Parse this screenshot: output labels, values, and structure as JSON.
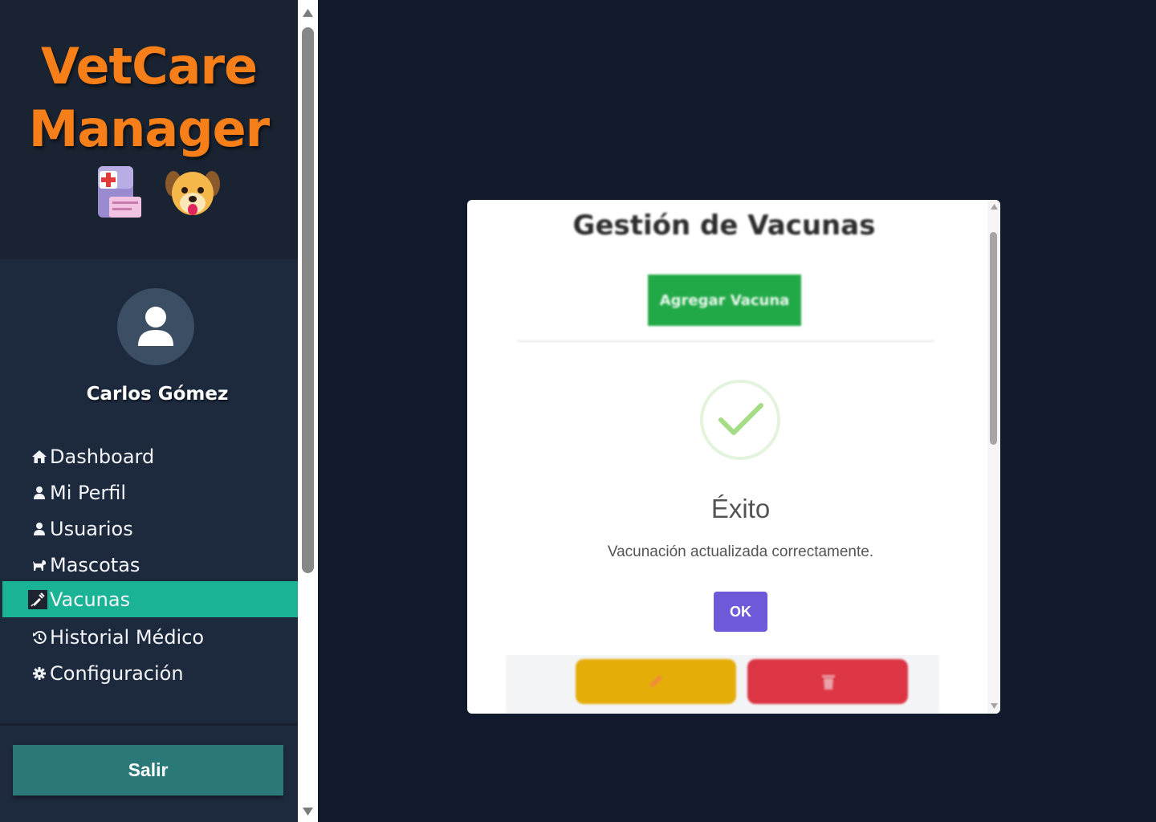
{
  "brand": {
    "line1": "VetCare",
    "line2": "Manager",
    "icons": [
      "clipboard-medical-icon",
      "dog-face-icon"
    ]
  },
  "user": {
    "name": "Carlos Gómez",
    "avatar_icon": "user-icon"
  },
  "nav": {
    "items": [
      {
        "label": "Dashboard",
        "icon": "home-icon"
      },
      {
        "label": "Mi Perfil",
        "icon": "user-icon"
      },
      {
        "label": "Usuarios",
        "icon": "user-icon"
      },
      {
        "label": "Mascotas",
        "icon": "dog-icon"
      },
      {
        "label": "Vacunas",
        "icon": "syringe-icon",
        "active": true
      },
      {
        "label": "Historial Médico",
        "icon": "history-icon"
      },
      {
        "label": "Configuración",
        "icon": "gear-icon"
      }
    ]
  },
  "logout": {
    "label": "Salir"
  },
  "panel": {
    "title": "Gestión de Vacunas",
    "add_button": "Agregar Vacuna",
    "edit_icon": "pencil-icon",
    "delete_icon": "trash-icon"
  },
  "alert": {
    "icon": "success-check-icon",
    "title": "Éxito",
    "message": "Vacunación actualizada correctamente.",
    "confirm": "OK"
  },
  "colors": {
    "brand": "#f77f1a",
    "active_nav": "#1bb395",
    "logout": "#2b7878",
    "add": "#22a947",
    "edit": "#e5ad08",
    "delete": "#dc3544",
    "confirm": "#6e5ad8"
  }
}
